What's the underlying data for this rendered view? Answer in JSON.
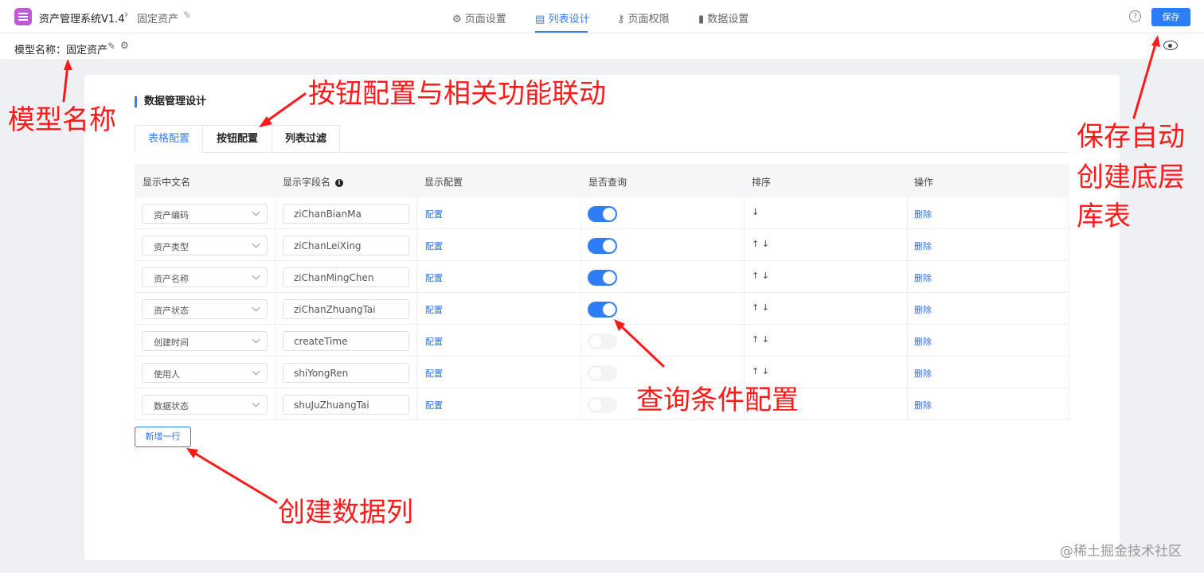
{
  "header": {
    "app_title": "资产管理系统V1.4",
    "crumb_sep": "›",
    "crumb": "固定资产",
    "nav": [
      {
        "label": "页面设置",
        "icon": "gear-icon",
        "active": false
      },
      {
        "label": "列表设计",
        "icon": "list-icon",
        "active": true
      },
      {
        "label": "页面权限",
        "icon": "key-icon",
        "active": false
      },
      {
        "label": "数据设置",
        "icon": "bar-chart-icon",
        "active": false
      }
    ],
    "help_glyph": "?",
    "save_label": "保存"
  },
  "model": {
    "label": "模型名称：固定资产"
  },
  "panel": {
    "title": "数据管理设计",
    "tabs": [
      "表格配置",
      "按钮配置",
      "列表过滤"
    ],
    "columns": [
      "显示中文名",
      "显示字段名",
      "显示配置",
      "是否查询",
      "排序",
      "操作"
    ],
    "info_glyph": "i",
    "rows": [
      {
        "cn": "资产编码",
        "field": "ziChanBianMa",
        "config": "配置",
        "query": true,
        "sort": "↓",
        "action": "删除"
      },
      {
        "cn": "资产类型",
        "field": "ziChanLeiXing",
        "config": "配置",
        "query": true,
        "sort": "↑  ↓",
        "action": "删除"
      },
      {
        "cn": "资产名称",
        "field": "ziChanMingChen",
        "config": "配置",
        "query": true,
        "sort": "↑  ↓",
        "action": "删除"
      },
      {
        "cn": "资产状态",
        "field": "ziChanZhuangTai",
        "config": "配置",
        "query": true,
        "sort": "↑  ↓",
        "action": "删除"
      },
      {
        "cn": "创建时间",
        "field": "createTime",
        "config": "配置",
        "query": false,
        "sort": "↑  ↓",
        "action": "删除"
      },
      {
        "cn": "使用人",
        "field": "shiYongRen",
        "config": "配置",
        "query": false,
        "sort": "↑  ↓",
        "action": "删除"
      },
      {
        "cn": "数据状态",
        "field": "shuJuZhuangTai",
        "config": "配置",
        "query": false,
        "sort": "",
        "action": "删除"
      }
    ],
    "add_row": "新增一行"
  },
  "annotations": {
    "model_name": "模型名称",
    "button_config": "按钮配置与相关功能联动",
    "save_auto_1": "保存自动",
    "save_auto_2": "创建底层",
    "save_auto_3": "库表",
    "query_config": "查询条件配置",
    "create_column": "创建数据列",
    "color": "#ff1a1a"
  },
  "watermark": "@稀土掘金技术社区",
  "colors": {
    "accent": "#2f7df6",
    "brand_icon": "#c05ad6"
  }
}
